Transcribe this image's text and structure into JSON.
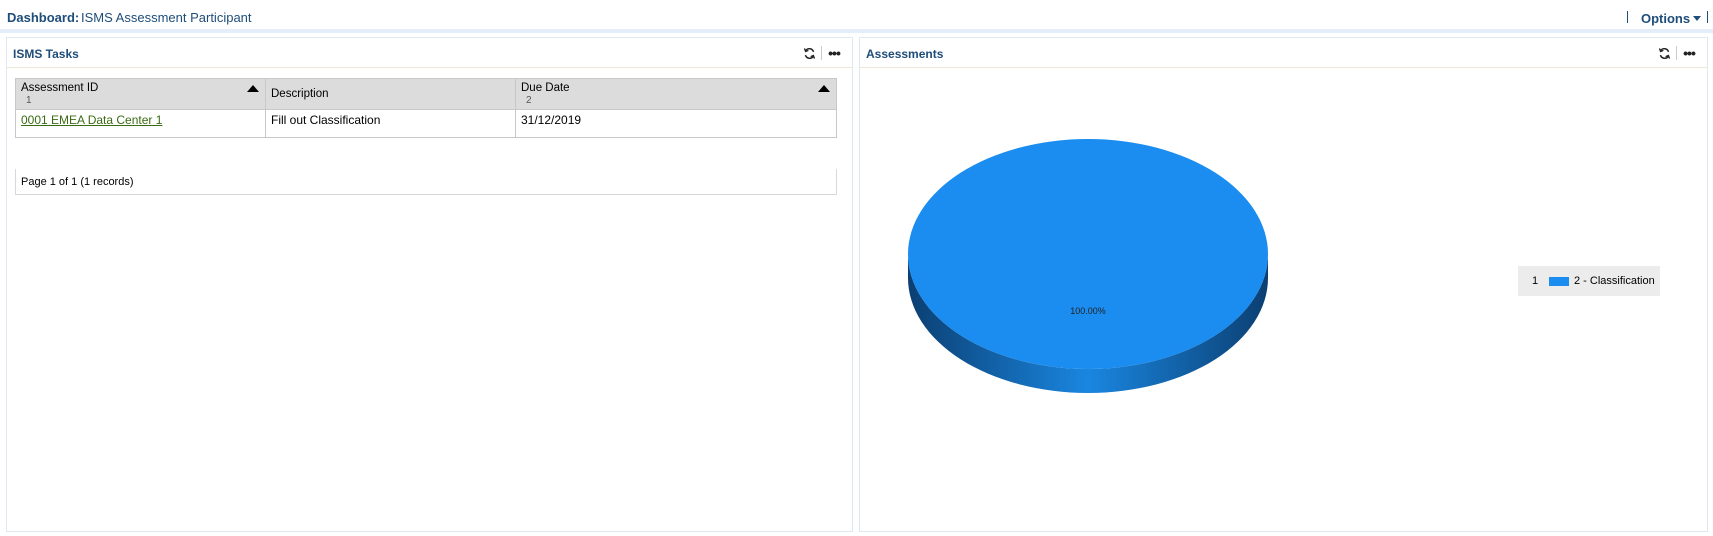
{
  "header": {
    "dashboard_label": "Dashboard:",
    "dashboard_name": "ISMS Assessment Participant",
    "options_label": "Options"
  },
  "tasks_panel": {
    "title": "ISMS Tasks",
    "columns": [
      {
        "label": "Assessment ID",
        "sort_order": "1",
        "sort_direction": "asc"
      },
      {
        "label": "Description",
        "sort_order": "",
        "sort_direction": "none"
      },
      {
        "label": "Due Date",
        "sort_order": "2",
        "sort_direction": "asc"
      }
    ],
    "rows": [
      {
        "assessment_id": "0001 EMEA Data Center 1",
        "description": "Fill out Classification",
        "due_date": "31/12/2019"
      }
    ],
    "pager_text": "Page 1 of 1 (1 records)"
  },
  "assessments_panel": {
    "title": "Assessments"
  },
  "icons": {
    "refresh": "refresh-icon",
    "more": "more-options-icon",
    "options_caret": "chevron-down-icon"
  },
  "colors": {
    "brand_text": "#1f4d7a",
    "pie_top": "#1b8df0",
    "pie_side": "#0c5fa8",
    "link": "#3a6b12"
  },
  "chart_data": {
    "type": "pie",
    "title": "",
    "slices": [
      {
        "legend_index": "1",
        "label": "2 - Classification",
        "value": 1,
        "percent_label": "100.00%",
        "color": "#1b8df0"
      }
    ],
    "legend_position": "right",
    "three_d": true
  }
}
